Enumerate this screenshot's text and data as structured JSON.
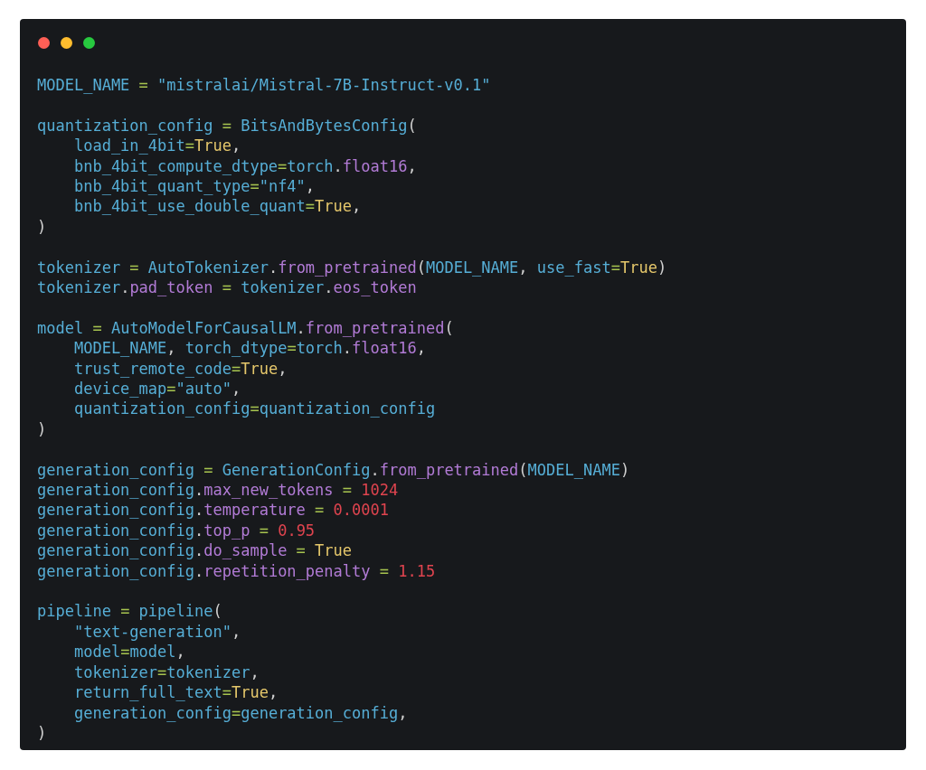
{
  "window": {
    "controls": [
      {
        "kind": "close"
      },
      {
        "kind": "minimize"
      },
      {
        "kind": "zoom"
      }
    ]
  },
  "code": {
    "blocks": [
      {
        "lines": [
          {
            "tokens": [
              {
                "text": "MODEL_NAME ",
                "kind": "name"
              },
              {
                "text": "=",
                "kind": "op"
              },
              {
                "text": " \"mistralai/Mistral-7B-Instruct-v0.1\"",
                "kind": "str"
              }
            ]
          }
        ]
      },
      {
        "lines": [
          {
            "tokens": [
              {
                "text": "quantization_config ",
                "kind": "name"
              },
              {
                "text": "=",
                "kind": "op"
              },
              {
                "text": " BitsAndBytesConfig",
                "kind": "name"
              },
              {
                "text": "(",
                "kind": "punct"
              }
            ]
          },
          {
            "tokens": [
              {
                "text": "    load_in_4bit",
                "kind": "name"
              },
              {
                "text": "=",
                "kind": "op"
              },
              {
                "text": "True",
                "kind": "const"
              },
              {
                "text": ",",
                "kind": "punct"
              }
            ]
          },
          {
            "tokens": [
              {
                "text": "    bnb_4bit_compute_dtype",
                "kind": "name"
              },
              {
                "text": "=",
                "kind": "op"
              },
              {
                "text": "torch",
                "kind": "name"
              },
              {
                "text": ".",
                "kind": "punct"
              },
              {
                "text": "float16",
                "kind": "member"
              },
              {
                "text": ",",
                "kind": "punct"
              }
            ]
          },
          {
            "tokens": [
              {
                "text": "    bnb_4bit_quant_type",
                "kind": "name"
              },
              {
                "text": "=",
                "kind": "op"
              },
              {
                "text": "\"nf4\"",
                "kind": "str"
              },
              {
                "text": ",",
                "kind": "punct"
              }
            ]
          },
          {
            "tokens": [
              {
                "text": "    bnb_4bit_use_double_quant",
                "kind": "name"
              },
              {
                "text": "=",
                "kind": "op"
              },
              {
                "text": "True",
                "kind": "const"
              },
              {
                "text": ",",
                "kind": "punct"
              }
            ]
          },
          {
            "tokens": [
              {
                "text": ")",
                "kind": "punct"
              }
            ]
          }
        ]
      },
      {
        "lines": [
          {
            "tokens": [
              {
                "text": "tokenizer ",
                "kind": "name"
              },
              {
                "text": "=",
                "kind": "op"
              },
              {
                "text": " AutoTokenizer",
                "kind": "name"
              },
              {
                "text": ".",
                "kind": "punct"
              },
              {
                "text": "from_pretrained",
                "kind": "member"
              },
              {
                "text": "(",
                "kind": "punct"
              },
              {
                "text": "MODEL_NAME",
                "kind": "name"
              },
              {
                "text": ", ",
                "kind": "punct"
              },
              {
                "text": "use_fast",
                "kind": "name"
              },
              {
                "text": "=",
                "kind": "op"
              },
              {
                "text": "True",
                "kind": "const"
              },
              {
                "text": ")",
                "kind": "punct"
              }
            ]
          },
          {
            "tokens": [
              {
                "text": "tokenizer",
                "kind": "name"
              },
              {
                "text": ".",
                "kind": "punct"
              },
              {
                "text": "pad_token ",
                "kind": "member"
              },
              {
                "text": "=",
                "kind": "op"
              },
              {
                "text": " tokenizer",
                "kind": "name"
              },
              {
                "text": ".",
                "kind": "punct"
              },
              {
                "text": "eos_token",
                "kind": "member"
              }
            ]
          }
        ]
      },
      {
        "lines": [
          {
            "tokens": [
              {
                "text": "model ",
                "kind": "name"
              },
              {
                "text": "=",
                "kind": "op"
              },
              {
                "text": " AutoModelForCausalLM",
                "kind": "name"
              },
              {
                "text": ".",
                "kind": "punct"
              },
              {
                "text": "from_pretrained",
                "kind": "member"
              },
              {
                "text": "(",
                "kind": "punct"
              }
            ]
          },
          {
            "tokens": [
              {
                "text": "    MODEL_NAME",
                "kind": "name"
              },
              {
                "text": ", ",
                "kind": "punct"
              },
              {
                "text": "torch_dtype",
                "kind": "name"
              },
              {
                "text": "=",
                "kind": "op"
              },
              {
                "text": "torch",
                "kind": "name"
              },
              {
                "text": ".",
                "kind": "punct"
              },
              {
                "text": "float16",
                "kind": "member"
              },
              {
                "text": ",",
                "kind": "punct"
              }
            ]
          },
          {
            "tokens": [
              {
                "text": "    trust_remote_code",
                "kind": "name"
              },
              {
                "text": "=",
                "kind": "op"
              },
              {
                "text": "True",
                "kind": "const"
              },
              {
                "text": ",",
                "kind": "punct"
              }
            ]
          },
          {
            "tokens": [
              {
                "text": "    device_map",
                "kind": "name"
              },
              {
                "text": "=",
                "kind": "op"
              },
              {
                "text": "\"auto\"",
                "kind": "str"
              },
              {
                "text": ",",
                "kind": "punct"
              }
            ]
          },
          {
            "tokens": [
              {
                "text": "    quantization_config",
                "kind": "name"
              },
              {
                "text": "=",
                "kind": "op"
              },
              {
                "text": "quantization_config",
                "kind": "name"
              }
            ]
          },
          {
            "tokens": [
              {
                "text": ")",
                "kind": "punct"
              }
            ]
          }
        ]
      },
      {
        "lines": [
          {
            "tokens": [
              {
                "text": "generation_config ",
                "kind": "name"
              },
              {
                "text": "=",
                "kind": "op"
              },
              {
                "text": " GenerationConfig",
                "kind": "name"
              },
              {
                "text": ".",
                "kind": "punct"
              },
              {
                "text": "from_pretrained",
                "kind": "member"
              },
              {
                "text": "(",
                "kind": "punct"
              },
              {
                "text": "MODEL_NAME",
                "kind": "name"
              },
              {
                "text": ")",
                "kind": "punct"
              }
            ]
          },
          {
            "tokens": [
              {
                "text": "generation_config",
                "kind": "name"
              },
              {
                "text": ".",
                "kind": "punct"
              },
              {
                "text": "max_new_tokens ",
                "kind": "member"
              },
              {
                "text": "=",
                "kind": "op"
              },
              {
                "text": " 1024",
                "kind": "num"
              }
            ]
          },
          {
            "tokens": [
              {
                "text": "generation_config",
                "kind": "name"
              },
              {
                "text": ".",
                "kind": "punct"
              },
              {
                "text": "temperature ",
                "kind": "member"
              },
              {
                "text": "=",
                "kind": "op"
              },
              {
                "text": " 0.0001",
                "kind": "num"
              }
            ]
          },
          {
            "tokens": [
              {
                "text": "generation_config",
                "kind": "name"
              },
              {
                "text": ".",
                "kind": "punct"
              },
              {
                "text": "top_p ",
                "kind": "member"
              },
              {
                "text": "=",
                "kind": "op"
              },
              {
                "text": " 0.95",
                "kind": "num"
              }
            ]
          },
          {
            "tokens": [
              {
                "text": "generation_config",
                "kind": "name"
              },
              {
                "text": ".",
                "kind": "punct"
              },
              {
                "text": "do_sample ",
                "kind": "member"
              },
              {
                "text": "=",
                "kind": "op"
              },
              {
                "text": " True",
                "kind": "const"
              }
            ]
          },
          {
            "tokens": [
              {
                "text": "generation_config",
                "kind": "name"
              },
              {
                "text": ".",
                "kind": "punct"
              },
              {
                "text": "repetition_penalty ",
                "kind": "member"
              },
              {
                "text": "=",
                "kind": "op"
              },
              {
                "text": " 1.15",
                "kind": "num"
              }
            ]
          }
        ]
      },
      {
        "lines": [
          {
            "tokens": [
              {
                "text": "pipeline ",
                "kind": "name"
              },
              {
                "text": "=",
                "kind": "op"
              },
              {
                "text": " pipeline",
                "kind": "name"
              },
              {
                "text": "(",
                "kind": "punct"
              }
            ]
          },
          {
            "tokens": [
              {
                "text": "    \"text-generation\"",
                "kind": "str"
              },
              {
                "text": ",",
                "kind": "punct"
              }
            ]
          },
          {
            "tokens": [
              {
                "text": "    model",
                "kind": "name"
              },
              {
                "text": "=",
                "kind": "op"
              },
              {
                "text": "model",
                "kind": "name"
              },
              {
                "text": ",",
                "kind": "punct"
              }
            ]
          },
          {
            "tokens": [
              {
                "text": "    tokenizer",
                "kind": "name"
              },
              {
                "text": "=",
                "kind": "op"
              },
              {
                "text": "tokenizer",
                "kind": "name"
              },
              {
                "text": ",",
                "kind": "punct"
              }
            ]
          },
          {
            "tokens": [
              {
                "text": "    return_full_text",
                "kind": "name"
              },
              {
                "text": "=",
                "kind": "op"
              },
              {
                "text": "True",
                "kind": "const"
              },
              {
                "text": ",",
                "kind": "punct"
              }
            ]
          },
          {
            "tokens": [
              {
                "text": "    generation_config",
                "kind": "name"
              },
              {
                "text": "=",
                "kind": "op"
              },
              {
                "text": "generation_config",
                "kind": "name"
              },
              {
                "text": ",",
                "kind": "punct"
              }
            ]
          },
          {
            "tokens": [
              {
                "text": ")",
                "kind": "punct"
              }
            ]
          }
        ]
      }
    ]
  }
}
